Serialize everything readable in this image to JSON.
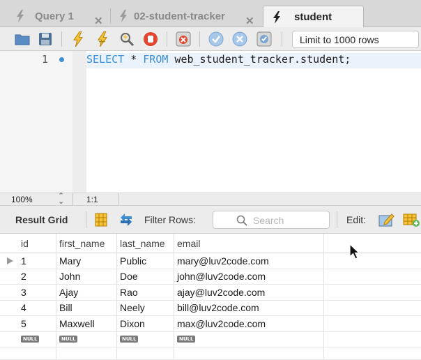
{
  "tabs": [
    {
      "label": "Query 1",
      "closable": true,
      "active": false
    },
    {
      "label": "02-student-tracker",
      "closable": true,
      "active": false
    },
    {
      "label": "student",
      "closable": false,
      "active": true
    }
  ],
  "toolbar": {
    "limit_select": "Limit to 1000 rows",
    "icons": [
      "open-folder-icon",
      "save-icon",
      "execute-icon",
      "execute-current-icon",
      "explain-icon",
      "stop-icon",
      "toggle-error-icon",
      "commit-icon",
      "rollback-icon",
      "autocommit-icon"
    ]
  },
  "editor": {
    "line_number": "1",
    "keywords": [
      "SELECT",
      "FROM"
    ],
    "select_kw": "SELECT",
    "star": " * ",
    "from_kw": "FROM",
    "rest": " web_student_tracker.student;",
    "accent_color": "#3d8fd6"
  },
  "status": {
    "zoom": "100%",
    "position": "1:1"
  },
  "results": {
    "label": "Result Grid",
    "filter_label": "Filter Rows:",
    "search_placeholder": "Search",
    "edit_label": "Edit:"
  },
  "grid": {
    "columns": [
      "id",
      "first_name",
      "last_name",
      "email"
    ],
    "rows": [
      [
        "1",
        "Mary",
        "Public",
        "mary@luv2code.com"
      ],
      [
        "2",
        "John",
        "Doe",
        "john@luv2code.com"
      ],
      [
        "3",
        "Ajay",
        "Rao",
        "ajay@luv2code.com"
      ],
      [
        "4",
        "Bill",
        "Neely",
        "bill@luv2code.com"
      ],
      [
        "5",
        "Maxwell",
        "Dixon",
        "max@luv2code.com"
      ]
    ],
    "null_label": "NULL"
  }
}
